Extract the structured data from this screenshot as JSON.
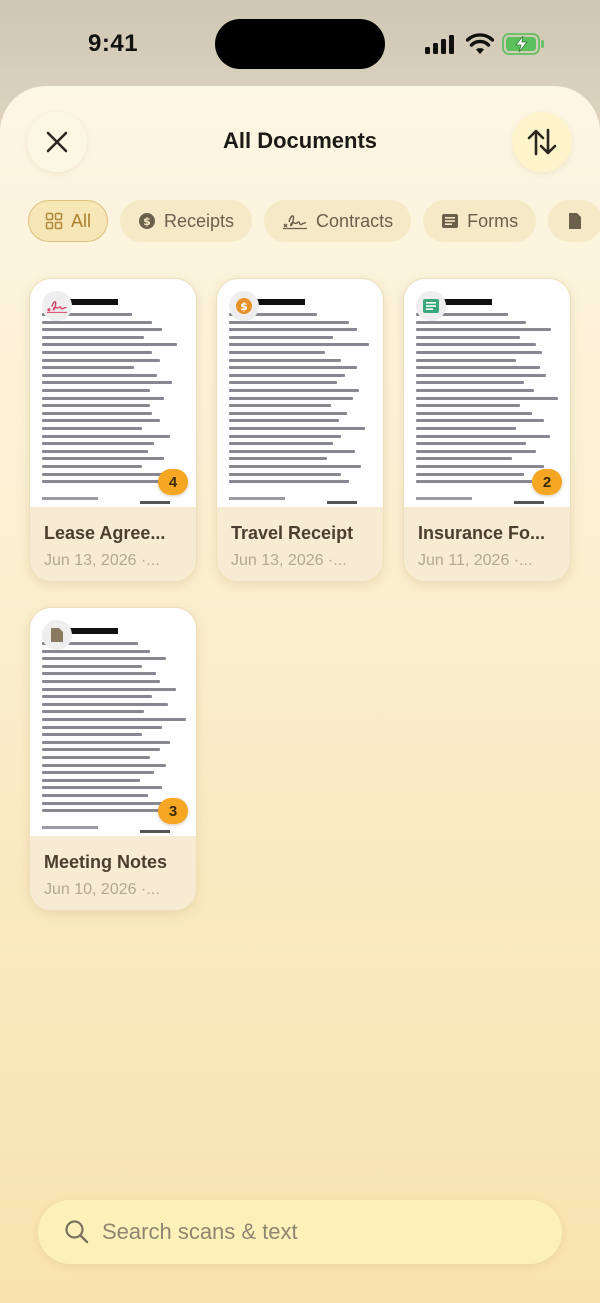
{
  "status_bar": {
    "time": "9:41"
  },
  "header": {
    "title": "All Documents"
  },
  "filters": [
    {
      "label": "All",
      "icon": "grid-icon",
      "active": true
    },
    {
      "label": "Receipts",
      "icon": "dollar-circle-icon"
    },
    {
      "label": "Contracts",
      "icon": "signature-icon"
    },
    {
      "label": "Forms",
      "icon": "form-icon"
    },
    {
      "label": "",
      "icon": "document-icon"
    }
  ],
  "documents": [
    {
      "name": "Lease Agree...",
      "date": "Jun 13, 2026  ·...",
      "pages": "4",
      "type_icon": "signature-icon"
    },
    {
      "name": "Travel Receipt",
      "date": "Jun 13, 2026  ·...",
      "pages": "",
      "type_icon": "dollar-circle-icon"
    },
    {
      "name": "Insurance Fo...",
      "date": "Jun 11, 2026  ·...",
      "pages": "2",
      "type_icon": "form-icon"
    },
    {
      "name": "Meeting Notes",
      "date": "Jun 10, 2026  ·...",
      "pages": "3",
      "type_icon": "document-icon"
    }
  ],
  "search": {
    "placeholder": "Search scans & text"
  },
  "colors": {
    "accent": "#f5a623",
    "chip_active_text": "#a8822e",
    "sheet_bg": "#fbefcf"
  }
}
